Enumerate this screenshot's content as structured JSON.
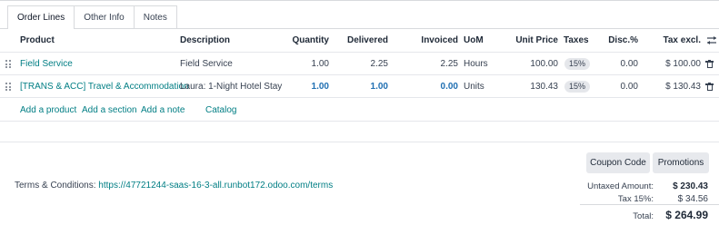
{
  "tabs": [
    "Order Lines",
    "Other Info",
    "Notes"
  ],
  "columns": {
    "product": "Product",
    "description": "Description",
    "quantity": "Quantity",
    "delivered": "Delivered",
    "invoiced": "Invoiced",
    "uom": "UoM",
    "unit_price": "Unit Price",
    "taxes": "Taxes",
    "disc": "Disc.%",
    "tax_excl": "Tax excl."
  },
  "lines": [
    {
      "product": "Field Service",
      "description": "Field Service",
      "quantity": "1.00",
      "delivered": "2.25",
      "invoiced": "2.25",
      "uom": "Hours",
      "unit_price": "100.00",
      "tax": "15%",
      "disc": "0.00",
      "subtotal": "$ 100.00"
    },
    {
      "product": "[TRANS & ACC] Travel & Accommodation",
      "description": "Laura: 1-Night Hotel Stay",
      "quantity": "1.00",
      "delivered": "1.00",
      "invoiced": "0.00",
      "uom": "Units",
      "unit_price": "130.43",
      "tax": "15%",
      "disc": "0.00",
      "subtotal": "$ 130.43"
    }
  ],
  "add_links": {
    "product": "Add a product",
    "section": "Add a section",
    "note": "Add a note",
    "catalog": "Catalog"
  },
  "buttons": {
    "coupon": "Coupon Code",
    "promotions": "Promotions"
  },
  "terms": {
    "label": "Terms & Conditions:",
    "url": "https://47721244-saas-16-3-all.runbot172.odoo.com/terms"
  },
  "totals": {
    "untaxed_label": "Untaxed Amount:",
    "untaxed_value": "$ 230.43",
    "tax_label": "Tax 15%:",
    "tax_value": "$ 34.56",
    "total_label": "Total:",
    "total_value": "$ 264.99"
  },
  "colors": {
    "link": "#017e84",
    "blue_value": "#1f6fb2",
    "button_bg": "#e7e9ed"
  }
}
